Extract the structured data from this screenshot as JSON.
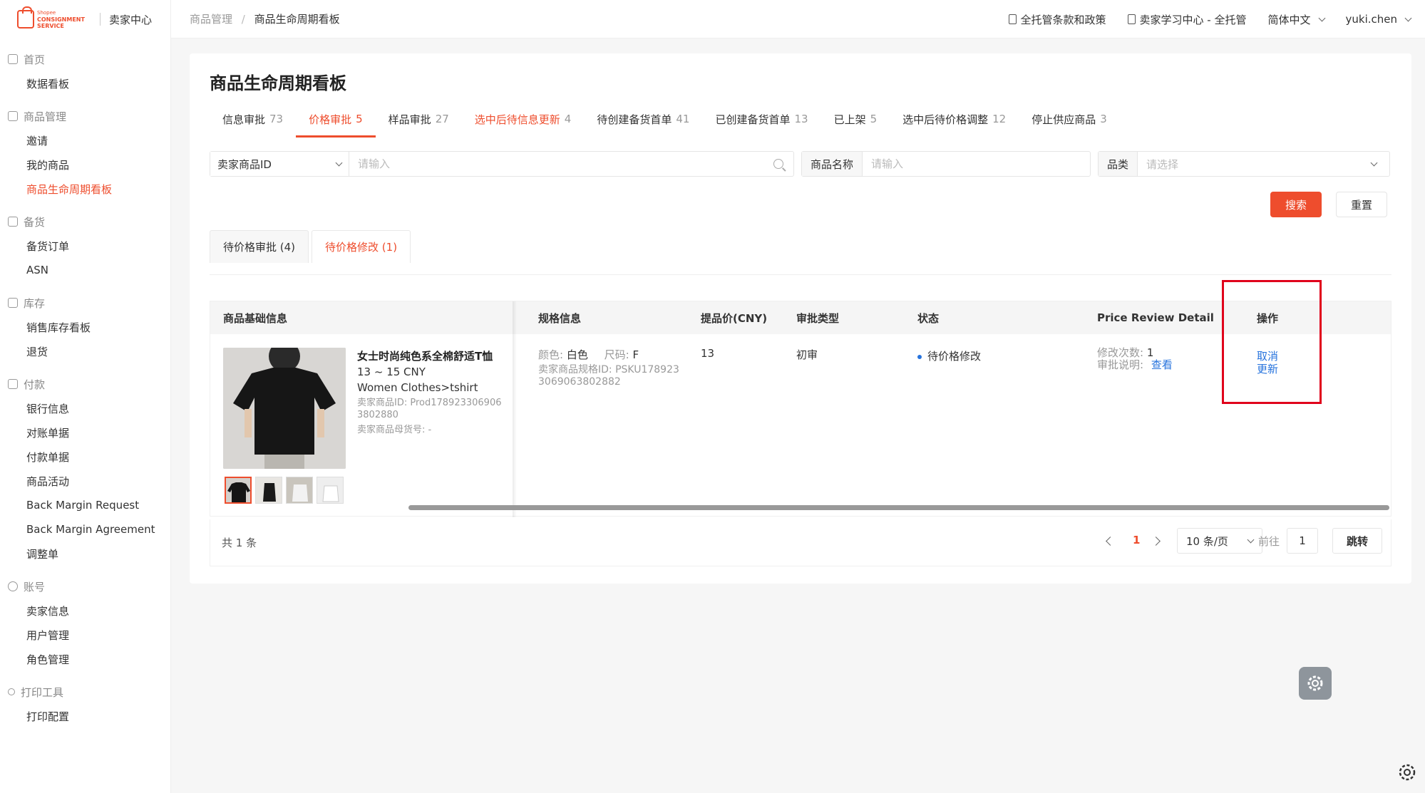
{
  "brand": {
    "logo_top": "Shopee",
    "logo_line1": "CONSIGNMENT",
    "logo_line2": "SERVICE",
    "title": "卖家中心"
  },
  "sidebar": {
    "groups": [
      {
        "title": "首页",
        "items": [
          {
            "label": "数据看板"
          }
        ]
      },
      {
        "title": "商品管理",
        "items": [
          {
            "label": "邀请"
          },
          {
            "label": "我的商品"
          },
          {
            "label": "商品生命周期看板",
            "active": true
          }
        ]
      },
      {
        "title": "备货",
        "items": [
          {
            "label": "备货订单"
          },
          {
            "label": "ASN"
          }
        ]
      },
      {
        "title": "库存",
        "items": [
          {
            "label": "销售库存看板"
          },
          {
            "label": "退货"
          }
        ]
      },
      {
        "title": "付款",
        "items": [
          {
            "label": "银行信息"
          },
          {
            "label": "对账单据"
          },
          {
            "label": "付款单据"
          },
          {
            "label": "商品活动"
          },
          {
            "label": "Back Margin Request"
          },
          {
            "label": "Back Margin Agreement"
          },
          {
            "label": "调整单"
          }
        ]
      },
      {
        "title": "账号",
        "items": [
          {
            "label": "卖家信息"
          },
          {
            "label": "用户管理"
          },
          {
            "label": "角色管理"
          }
        ]
      },
      {
        "title": "打印工具",
        "items": [
          {
            "label": "打印配置"
          }
        ]
      }
    ]
  },
  "topbar": {
    "breadcrumb": [
      "商品管理",
      "商品生命周期看板"
    ],
    "links": [
      "全托管条款和政策",
      "卖家学习中心 - 全托管"
    ],
    "language": "简体中文",
    "user": "yuki.chen"
  },
  "page": {
    "title": "商品生命周期看板",
    "tabs": [
      {
        "label": "信息审批",
        "count": "73"
      },
      {
        "label": "价格审批",
        "count": "5",
        "active": true
      },
      {
        "label": "样品审批",
        "count": "27"
      },
      {
        "label": "选中后待信息更新",
        "count": "4",
        "alert": true
      },
      {
        "label": "待创建备货首单",
        "count": "41"
      },
      {
        "label": "已创建备货首单",
        "count": "13"
      },
      {
        "label": "已上架",
        "count": "5"
      },
      {
        "label": "选中后待价格调整",
        "count": "12"
      },
      {
        "label": "停止供应商品",
        "count": "3"
      }
    ],
    "filters": {
      "id_select": "卖家商品ID",
      "id_placeholder": "请输入",
      "name_label": "商品名称",
      "name_placeholder": "请输入",
      "category_label": "品类",
      "category_placeholder": "请选择"
    },
    "search_label": "搜索",
    "reset_label": "重置",
    "subtabs": [
      {
        "label": "待价格审批 (4)"
      },
      {
        "label": "待价格修改 (1)",
        "active": true
      }
    ]
  },
  "table": {
    "headers": [
      "商品基础信息",
      "规格信息",
      "提品价(CNY)",
      "审批类型",
      "状态",
      "Price Review Detail",
      "操作"
    ],
    "row": {
      "title": "女士时尚纯色系全棉舒适T恤",
      "price_range": "13 ~ 15 CNY",
      "category": "Women Clothes>tshirt",
      "seller_id": "卖家商品ID: Prod1789233069063802880",
      "parent_sku": "卖家商品母货号: -",
      "color_label": "颜色:",
      "color_value": "白色",
      "size_label": "尺码:",
      "size_value": "F",
      "spec_id": "卖家商品规格ID: PSKU1789233069063802882",
      "price": "13",
      "approval_type": "初审",
      "status": "待价格修改",
      "edit_count_label": "修改次数:",
      "edit_count": "1",
      "remark_label": "审批说明:",
      "remark_link": "查看",
      "action_line1": "取消",
      "action_line2": "更新"
    }
  },
  "pagination": {
    "total": "共 1 条",
    "current": "1",
    "page_size": "10 条/页",
    "goto_label": "前往",
    "goto_value": "1",
    "jump_label": "跳转"
  },
  "colors": {
    "accent": "#ee4d2d",
    "link": "#2673dd",
    "highlight": "#e0001b"
  }
}
